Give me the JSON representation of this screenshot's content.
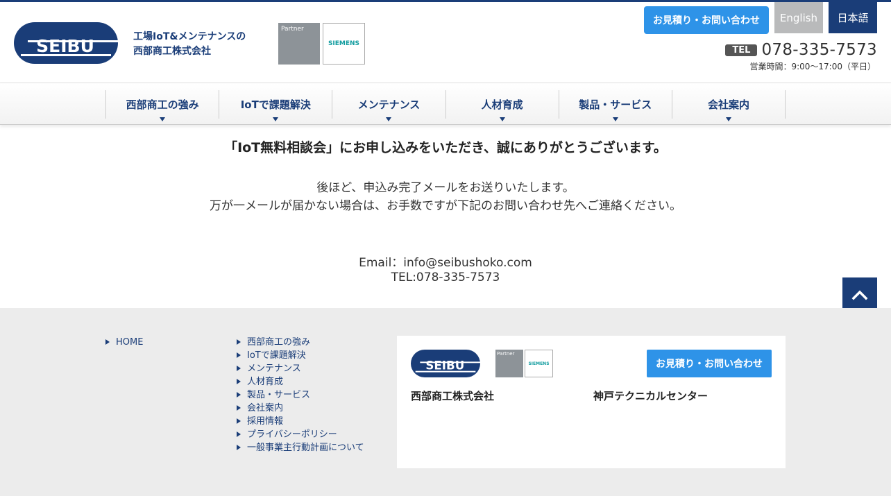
{
  "colors": {
    "brand": "#1a3d78",
    "accent": "#2e93e8",
    "lang_inactive": "#b9babb",
    "footer_bg": "#ececec"
  },
  "header": {
    "logo_text": "SEIBU",
    "tagline_1": "工場IoT&メンテナンスの",
    "tagline_2": "西部商工株式会社",
    "partner_label": "Partner",
    "siemens_label": "SIEMENS",
    "estimate_button": "お見積り・お問い合わせ",
    "lang_en": "English",
    "lang_ja": "日本語",
    "tel_badge": "TEL",
    "tel_number": "078-335-7573",
    "hours": "営業時間：9:00〜17:00（平日）"
  },
  "nav": {
    "items": [
      {
        "label": "西部商工の強み"
      },
      {
        "label": "IoTで課題解決"
      },
      {
        "label": "メンテナンス"
      },
      {
        "label": "人材育成"
      },
      {
        "label": "製品・サービス"
      },
      {
        "label": "会社案内"
      }
    ]
  },
  "main": {
    "headline": "「IoT無料相談会」にお申し込みをいただき、誠にありがとうございます。",
    "line1": "後ほど、申込み完了メールをお送りいたします。",
    "line2": "万が一メールが届かない場合は、お手数ですが下記のお問い合わせ先へご連絡ください。",
    "email": "Email：info@seibushoko.com",
    "tel": "TEL:078-335-7573"
  },
  "footer": {
    "col1": [
      "HOME"
    ],
    "col2": [
      "西部商工の強み",
      "IoTで課題解決",
      "メンテナンス",
      "人材育成",
      "製品・サービス",
      "会社案内",
      "採用情報",
      "プライバシーポリシー",
      "一般事業主行動計画について"
    ],
    "logo_text": "SEIBU",
    "partner_label": "Partner",
    "siemens_label": "SIEMENS",
    "estimate_button": "お見積り・お問い合わせ",
    "company": "西部商工株式会社",
    "center": "神戸テクニカルセンター"
  }
}
